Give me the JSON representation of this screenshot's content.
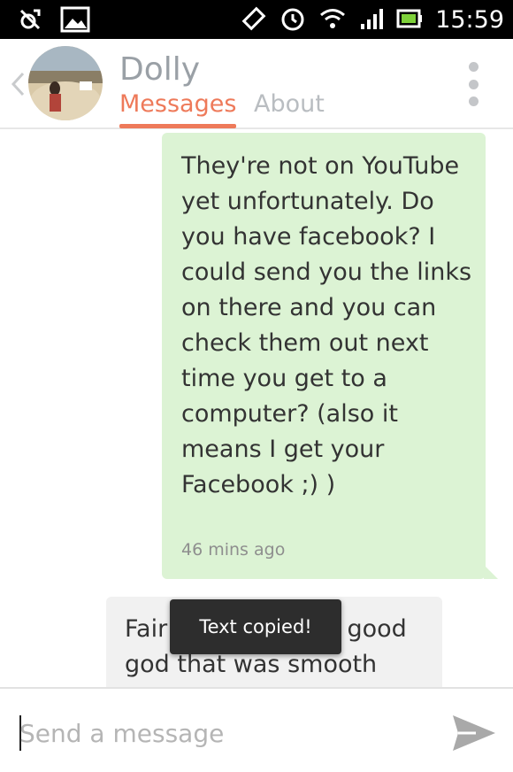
{
  "status_bar": {
    "time": "15:59"
  },
  "contact": {
    "name": "Dolly"
  },
  "tabs": {
    "messages": "Messages",
    "about": "About"
  },
  "messages": [
    {
      "direction": "outgoing",
      "text": "They're not on YouTube yet unfortunately. Do you have facebook? I could send you the links on there and you can check them out next time you get to a computer? (also it means I get your Facebook ;) )",
      "time": "46 mins ago"
    },
    {
      "direction": "incoming",
      "text": "Fair enough haha, good god that was smooth"
    }
  ],
  "toast": {
    "text": "Text copied!"
  },
  "composer": {
    "placeholder": "Send a message"
  },
  "colors": {
    "accent": "#ee7a5a",
    "outgoing_bubble": "#dcf3d4",
    "incoming_bubble": "#f1f1f1"
  },
  "icons": [
    "location-off-icon",
    "image-icon",
    "vibrate-icon",
    "alarm-icon",
    "wifi-icon",
    "signal-icon",
    "battery-icon",
    "back-chevron-icon",
    "overflow-menu-icon",
    "send-icon"
  ]
}
